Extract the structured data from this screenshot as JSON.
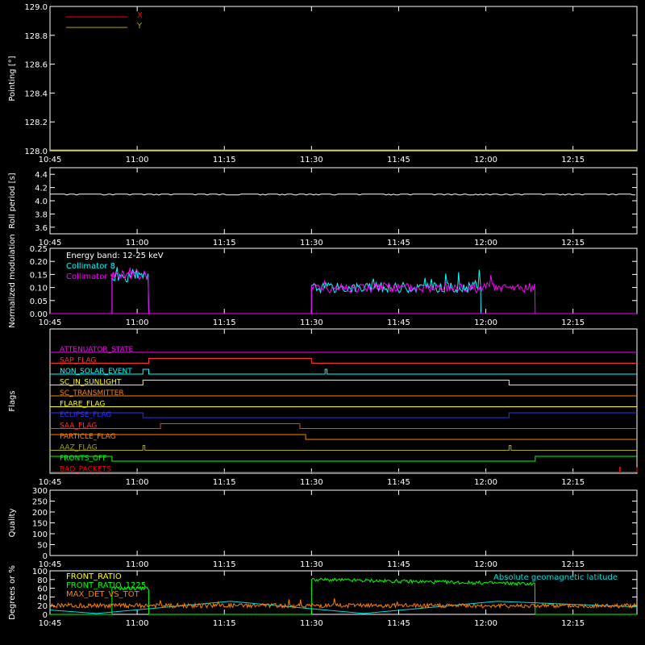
{
  "time_axis": {
    "start": "10:45",
    "end": "12:26",
    "ticks": [
      "10:45",
      "11:00",
      "11:15",
      "11:30",
      "11:45",
      "12:00",
      "12:15"
    ]
  },
  "colors": {
    "background": "#000000",
    "axes": "#ffffff",
    "x_line": "#ff0000",
    "y_line": "#aaaa00",
    "collimator_8": "#00ffff",
    "collimator_9": "#ff00ff",
    "front_ratio": "#ffff00",
    "front_ratio_1225": "#00ff00",
    "max_det_vs_tot": "#ff8000",
    "geomag": "#00dddd"
  },
  "chart_data": [
    {
      "id": "pointing",
      "type": "line",
      "ylabel": "Pointing [°]",
      "ylim": [
        128.0,
        129.0
      ],
      "yticks": [
        "128.0",
        "128.2",
        "128.4",
        "128.6",
        "128.8",
        "129.0"
      ],
      "legend": [
        "X",
        "Y"
      ],
      "series": [
        {
          "name": "X",
          "values": []
        },
        {
          "name": "Y",
          "values": [
            128.0,
            128.0
          ]
        }
      ]
    },
    {
      "id": "roll_period",
      "type": "line",
      "ylabel": "Roll period [s]",
      "ylim": [
        3.5,
        4.5
      ],
      "yticks": [
        "3.6",
        "3.8",
        "4.0",
        "4.2",
        "4.4"
      ],
      "series": [
        {
          "name": "roll",
          "x": [
            "10:45",
            "12:26"
          ],
          "values": [
            4.1,
            4.1
          ]
        }
      ]
    },
    {
      "id": "modulation",
      "type": "line",
      "ylabel": "Normalized modulation",
      "ylim": [
        0,
        0.25
      ],
      "yticks": [
        "0.00",
        "0.05",
        "0.10",
        "0.15",
        "0.20",
        "0.25"
      ],
      "annotation": "Energy band: 12-25 keV",
      "legend": [
        "Collimator 8",
        "Collimator 9"
      ],
      "series": [
        {
          "name": "Collimator 8",
          "segments": [
            [
              "10:55:40",
              "11:02:00",
              0.14
            ],
            [
              "11:30:00",
              "11:59:10",
              0.1
            ]
          ]
        },
        {
          "name": "Collimator 9",
          "segments": [
            [
              "10:55:40",
              "11:02:00",
              0.15
            ],
            [
              "11:30:00",
              "12:08:30",
              0.1
            ]
          ]
        }
      ]
    },
    {
      "id": "flags",
      "type": "line",
      "ylabel": "Flags",
      "flags": [
        {
          "name": "ATTENUATOR_STATE",
          "color": "#ff00ff",
          "transitions": []
        },
        {
          "name": "SAP_FLAG",
          "color": "#ff3030",
          "transitions": [
            [
              "11:02:00",
              1
            ],
            [
              "11:30:00",
              0
            ]
          ]
        },
        {
          "name": "NON_SOLAR_EVENT",
          "color": "#00ffff",
          "transitions": [
            [
              "11:01:00",
              1
            ],
            [
              "11:02:00",
              0
            ],
            [
              "11:32:20",
              1
            ],
            [
              "11:32:40",
              0
            ]
          ]
        },
        {
          "name": "SC_IN_SUNLIGHT",
          "color": "#ffff00",
          "transitions": [
            [
              "11:01:00",
              1
            ],
            [
              "12:04:00",
              0
            ]
          ]
        },
        {
          "name": "SC_TRANSMITTER",
          "color": "#ff8000",
          "transitions": []
        },
        {
          "name": "FLARE_FLAG",
          "color": "#ffff00",
          "transitions": []
        },
        {
          "name": "ECLIPSE_FLAG",
          "color": "#3030ff",
          "transitions": [
            [
              "11:01:00",
              0
            ],
            [
              "12:04:00",
              1
            ]
          ]
        },
        {
          "name": "SAA_FLAG",
          "color": "#ff3030",
          "transitions": [
            [
              "11:04:00",
              1
            ],
            [
              "11:28:00",
              0
            ]
          ]
        },
        {
          "name": "PARTICLE_FLAG",
          "color": "#ff8000",
          "transitions": [
            [
              "11:29:00",
              0
            ]
          ]
        },
        {
          "name": "AAZ_FLAG",
          "color": "#aaaa00",
          "transitions": [
            [
              "11:01:00",
              1
            ],
            [
              "11:01:20",
              0
            ],
            [
              "12:04:00",
              1
            ],
            [
              "12:04:20",
              0
            ]
          ]
        },
        {
          "name": "FRONTS_OFF",
          "color": "#00ff00",
          "transitions": [
            [
              "10:55:40",
              0
            ],
            [
              "12:08:30",
              1
            ]
          ]
        },
        {
          "name": "BAD_PACKETS",
          "color": "#ff0000",
          "transitions": [
            [
              "12:23:00",
              1
            ],
            [
              "12:23:10",
              0
            ],
            [
              "12:26:00",
              1
            ]
          ]
        }
      ]
    },
    {
      "id": "quality",
      "type": "line",
      "ylabel": "Quality",
      "ylim": [
        0,
        300
      ],
      "yticks": [
        "0",
        "50",
        "100",
        "150",
        "200",
        "250",
        "300"
      ],
      "series": []
    },
    {
      "id": "ratios",
      "type": "line",
      "ylabel": "Degrees or %",
      "ylim": [
        0,
        100
      ],
      "yticks": [
        "0",
        "20",
        "40",
        "60",
        "80",
        "100"
      ],
      "legend": [
        "FRONT_RATIO",
        "FRONT_RATIO_1225",
        "MAX_DET_VS_TOT"
      ],
      "annotation": "Absolute geomagnetic latitude",
      "series": [
        {
          "name": "FRONT_RATIO_1225",
          "segments": [
            [
              "10:55:40",
              "11:02:00",
              60
            ],
            [
              "11:30:00",
              "12:08:30",
              80
            ]
          ]
        },
        {
          "name": "MAX_DET_VS_TOT",
          "level": 20
        },
        {
          "name": "Absolute geomagnetic latitude",
          "x": [
            "10:45",
            "10:53",
            "11:16",
            "11:39",
            "12:02",
            "12:26"
          ],
          "values": [
            10,
            2,
            30,
            2,
            30,
            17
          ]
        }
      ]
    }
  ]
}
